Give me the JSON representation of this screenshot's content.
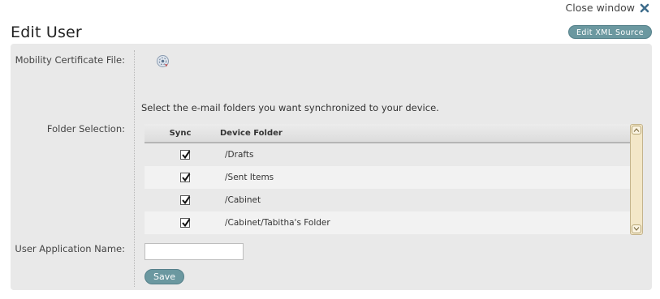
{
  "header": {
    "close_label": "Close window",
    "title": "Edit User",
    "xml_button_label": "Edit XML Source"
  },
  "form": {
    "cert_label": "Mobility Certificate File:",
    "folder_label": "Folder Selection:",
    "app_name_label": "User Application Name:",
    "instruction": "Select the e-mail folders you want synchronized to your device.",
    "app_name_value": "",
    "save_label": "Save"
  },
  "table": {
    "col_sync": "Sync",
    "col_folder": "Device Folder",
    "rows": [
      {
        "folder": "/Drafts",
        "checked": true
      },
      {
        "folder": "/Sent Items",
        "checked": true
      },
      {
        "folder": "/Cabinet",
        "checked": true
      },
      {
        "folder": "/Cabinet/Tabitha's Folder",
        "checked": true
      }
    ]
  },
  "icons": {
    "close": "close-icon",
    "certificate": "certificate-icon",
    "scroll_up": "scroll-up-icon",
    "scroll_down": "scroll-down-icon"
  },
  "colors": {
    "accent": "#6b98a0",
    "panel_bg": "#e9e9e9",
    "scrollbar": "#f3e7c8",
    "close_x": "#3f6d8c"
  }
}
